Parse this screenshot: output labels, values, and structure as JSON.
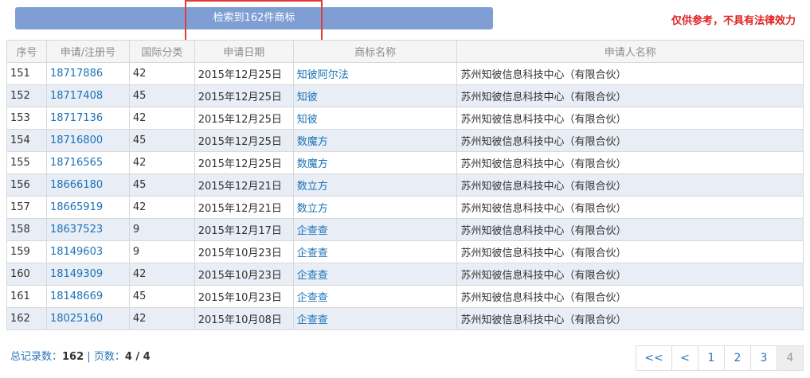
{
  "header": {
    "result_label": "检索到162件商标",
    "disclaimer": "仅供参考，不具有法律效力"
  },
  "table": {
    "columns": [
      "序号",
      "申请/注册号",
      "国际分类",
      "申请日期",
      "商标名称",
      "申请人名称"
    ],
    "rows": [
      [
        "151",
        "18717886",
        "42",
        "2015年12月25日",
        "知彼阿尔法",
        "苏州知彼信息科技中心（有限合伙）"
      ],
      [
        "152",
        "18717408",
        "45",
        "2015年12月25日",
        "知彼",
        "苏州知彼信息科技中心（有限合伙）"
      ],
      [
        "153",
        "18717136",
        "42",
        "2015年12月25日",
        "知彼",
        "苏州知彼信息科技中心（有限合伙）"
      ],
      [
        "154",
        "18716800",
        "45",
        "2015年12月25日",
        "数魔方",
        "苏州知彼信息科技中心（有限合伙）"
      ],
      [
        "155",
        "18716565",
        "42",
        "2015年12月25日",
        "数魔方",
        "苏州知彼信息科技中心（有限合伙）"
      ],
      [
        "156",
        "18666180",
        "45",
        "2015年12月21日",
        "数立方",
        "苏州知彼信息科技中心（有限合伙）"
      ],
      [
        "157",
        "18665919",
        "42",
        "2015年12月21日",
        "数立方",
        "苏州知彼信息科技中心（有限合伙）"
      ],
      [
        "158",
        "18637523",
        "9",
        "2015年12月17日",
        "企查查",
        "苏州知彼信息科技中心（有限合伙）"
      ],
      [
        "159",
        "18149603",
        "9",
        "2015年10月23日",
        "企查查",
        "苏州知彼信息科技中心（有限合伙）"
      ],
      [
        "160",
        "18149309",
        "42",
        "2015年10月23日",
        "企查查",
        "苏州知彼信息科技中心（有限合伙）"
      ],
      [
        "161",
        "18148669",
        "45",
        "2015年10月23日",
        "企查查",
        "苏州知彼信息科技中心（有限合伙）"
      ],
      [
        "162",
        "18025160",
        "42",
        "2015年10月08日",
        "企查查",
        "苏州知彼信息科技中心（有限合伙）"
      ]
    ]
  },
  "footer": {
    "total_label": "总记录数：",
    "total_value": "162",
    "separator": " | ",
    "pages_label": "页数：",
    "pages_value": "4 / 4"
  },
  "pager": {
    "first": "<<",
    "prev": "<",
    "pages": [
      "1",
      "2",
      "3",
      "4"
    ],
    "current": "4"
  }
}
